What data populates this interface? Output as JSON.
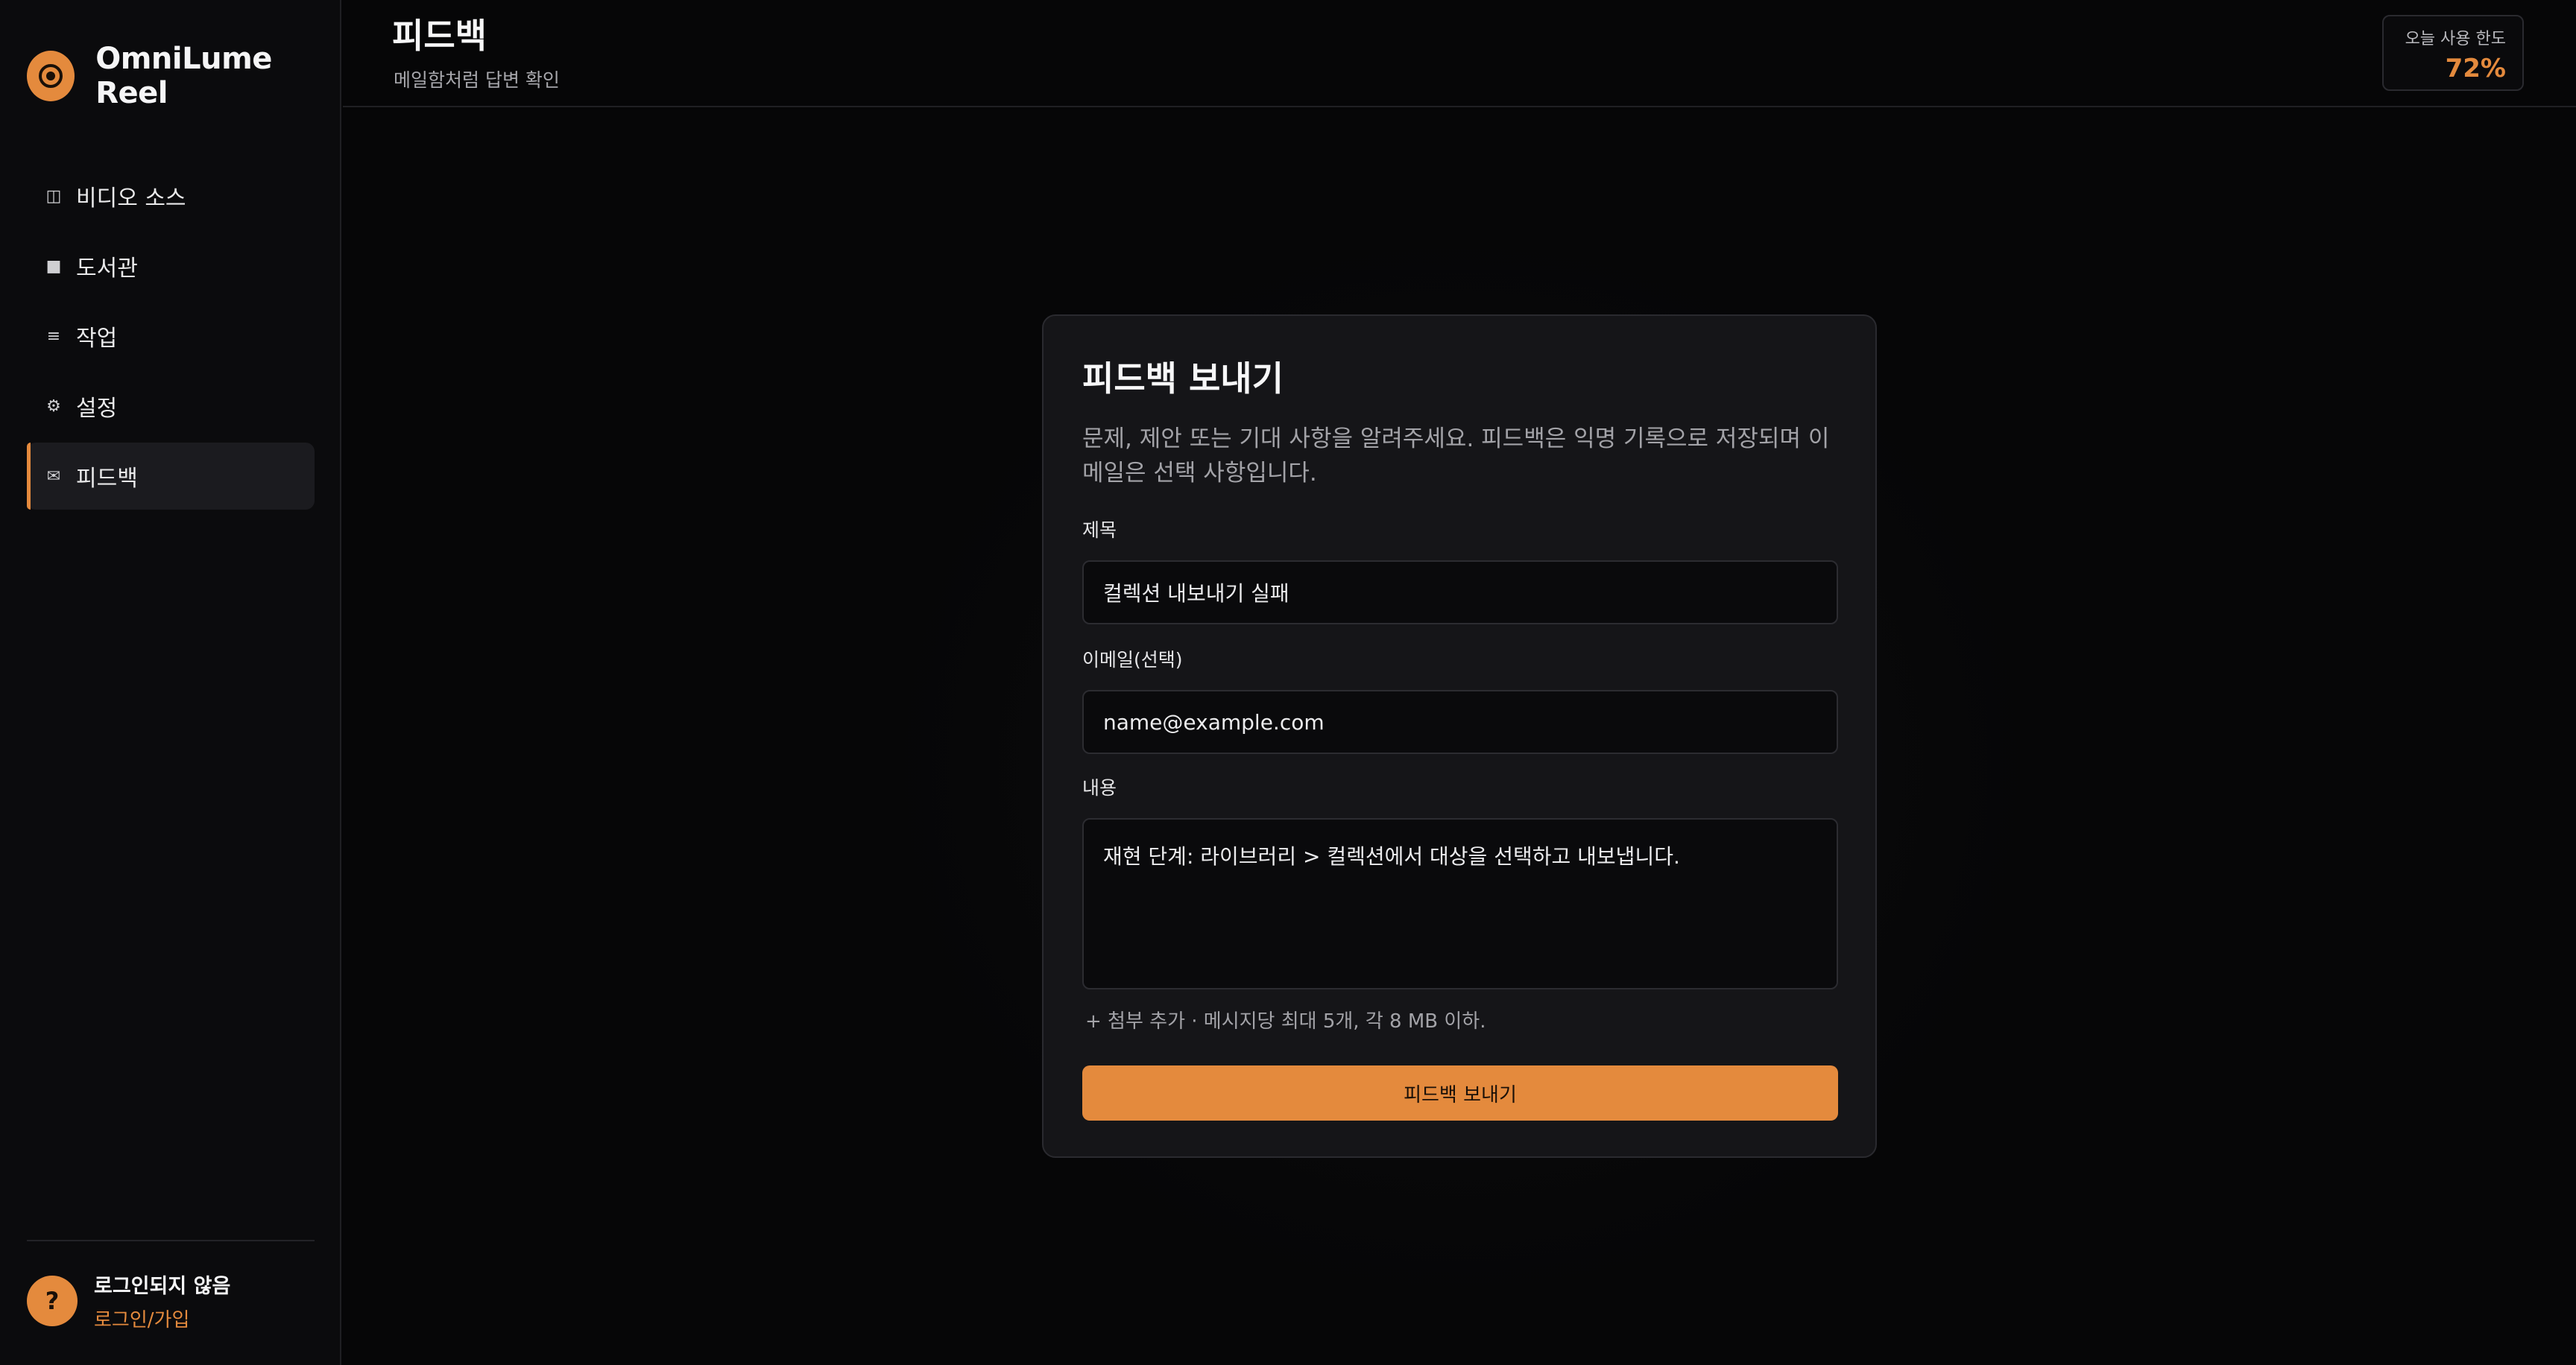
{
  "app": {
    "name": "OmniLume Reel"
  },
  "sidebar": {
    "items": [
      {
        "label": "비디오 소스",
        "icon": "columns-icon",
        "glyph": "◫",
        "active": false
      },
      {
        "label": "도서관",
        "icon": "square-icon",
        "glyph": "■",
        "active": false
      },
      {
        "label": "작업",
        "icon": "list-icon",
        "glyph": "≡",
        "active": false
      },
      {
        "label": "설정",
        "icon": "gear-icon",
        "glyph": "⚙",
        "active": false
      },
      {
        "label": "피드백",
        "icon": "mail-icon",
        "glyph": "✉",
        "active": true
      }
    ],
    "user": {
      "avatar": "?",
      "name": "로그인되지 않음",
      "link": "로그인/가입"
    }
  },
  "header": {
    "title": "피드백",
    "subtitle": "메일함처럼 답변 확인",
    "quota": {
      "label": "오늘 사용 한도",
      "value": "72%"
    }
  },
  "form": {
    "title": "피드백 보내기",
    "description": "문제, 제안 또는 기대 사항을 알려주세요. 피드백은 익명 기록으로 저장되며 이메일은 선택 사항입니다.",
    "subject": {
      "label": "제목",
      "value": "컬렉션 내보내기 실패"
    },
    "email": {
      "label": "이메일(선택)",
      "value": "name@example.com"
    },
    "content": {
      "label": "내용",
      "value": "재현 단계: 라이브러리 > 컬렉션에서 대상을 선택하고 내보냅니다."
    },
    "attachment_hint": "+ 첨부 추가 · 메시지당 최대 5개, 각 8 MB 이하.",
    "submit_label": "피드백 보내기"
  },
  "colors": {
    "accent": "#e48a3d",
    "background": "#060607",
    "card": "#151518"
  }
}
